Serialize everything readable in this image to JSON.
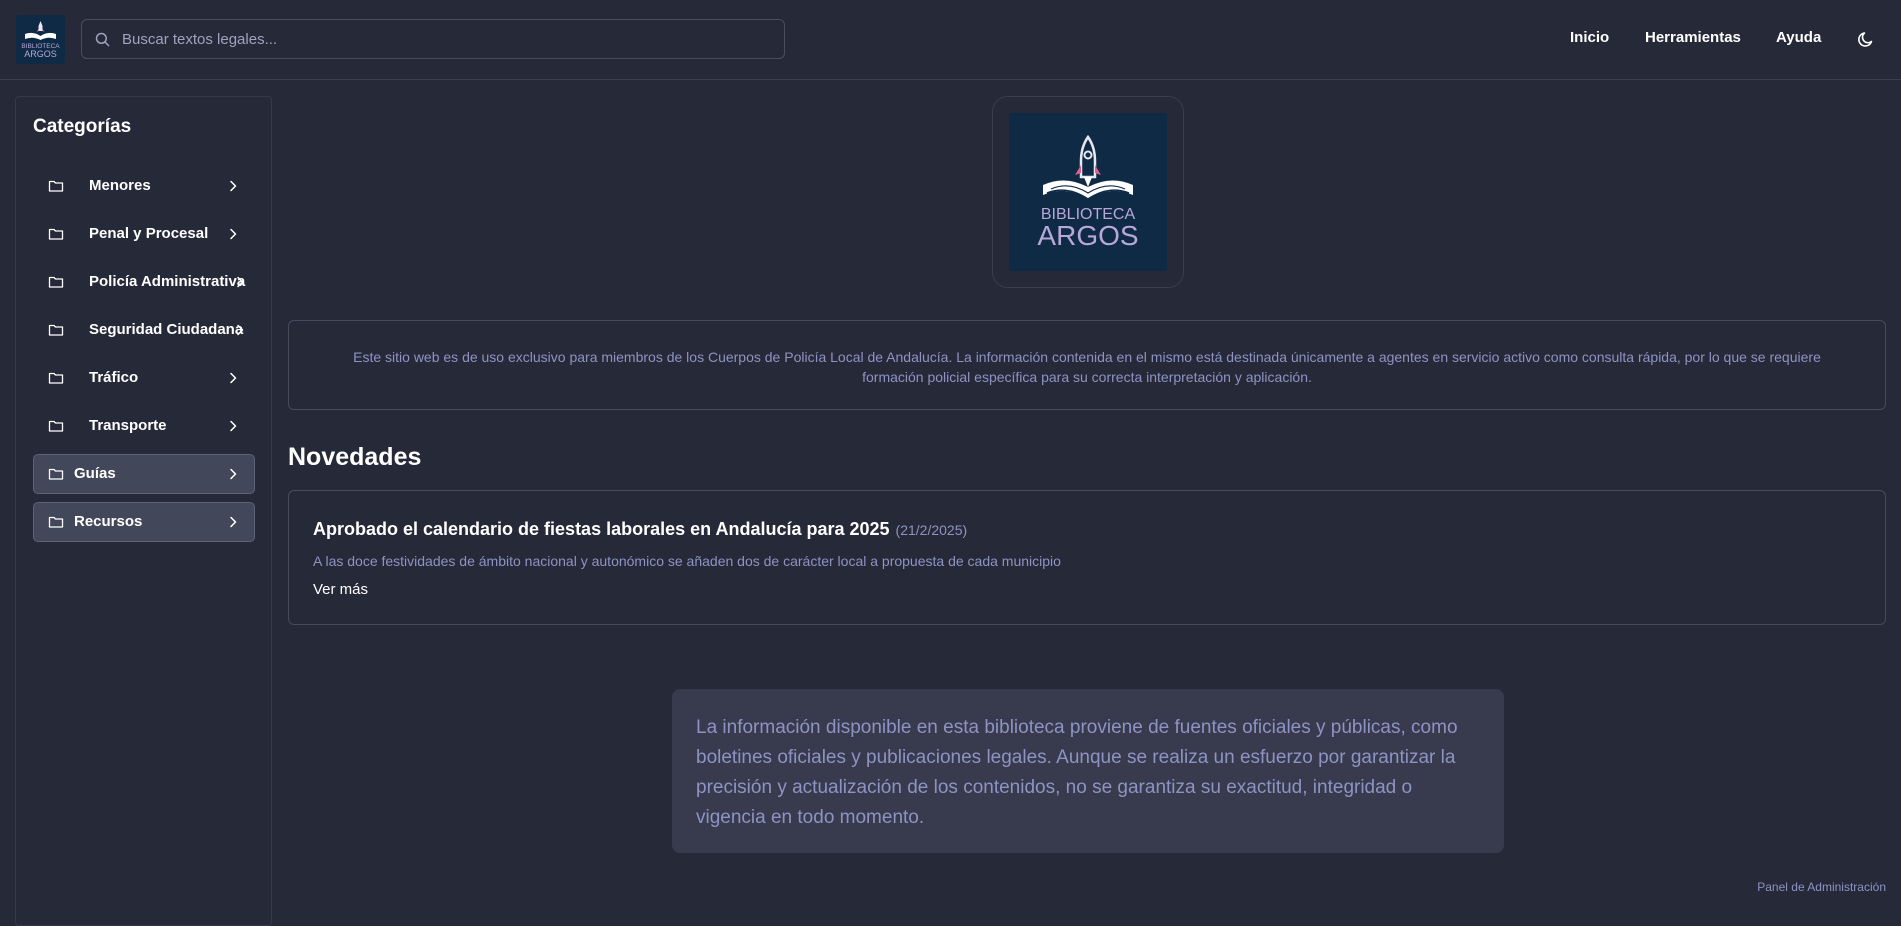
{
  "app": {
    "logo_text_top": "BIBLIOTECA",
    "logo_text_bottom": "ARGOS"
  },
  "header": {
    "search": {
      "placeholder": "Buscar textos legales...",
      "value": ""
    },
    "nav": [
      {
        "label": "Inicio"
      },
      {
        "label": "Herramientas"
      },
      {
        "label": "Ayuda"
      }
    ],
    "theme_toggle_icon": "moon-icon"
  },
  "sidebar": {
    "title": "Categorías",
    "items": [
      {
        "label": "Menores",
        "active": false
      },
      {
        "label": "Penal y Procesal",
        "active": false
      },
      {
        "label": "Policía Administrativa",
        "active": false
      },
      {
        "label": "Seguridad Ciudadana",
        "active": false
      },
      {
        "label": "Tráfico",
        "active": false
      },
      {
        "label": "Transporte",
        "active": false
      },
      {
        "label": "Guías",
        "active": true
      },
      {
        "label": "Recursos",
        "active": true
      }
    ]
  },
  "main": {
    "notice": "Este sitio web es de uso exclusivo para miembros de los Cuerpos de Policía Local de Andalucía. La información contenida en el mismo está destinada únicamente a agentes en servicio activo como consulta rápida, por lo que se requiere formación policial específica para su correcta interpretación y aplicación.",
    "news_section_title": "Novedades",
    "news": [
      {
        "title": "Aprobado el calendario de fiestas laborales en Andalucía para 2025",
        "date": "(21/2/2025)",
        "summary": "A las doce festividades de ámbito nacional y autonómico se añaden dos de carácter local a propuesta de cada municipio",
        "more_label": "Ver más"
      }
    ],
    "disclaimer": "La información disponible en esta biblioteca proviene de fuentes oficiales y públicas, como boletines oficiales y publicaciones legales. Aunque se realiza un esfuerzo por garantizar la precisión y actualización de los contenidos, no se garantiza su exactitud, integridad o vigencia en todo momento.",
    "admin_link": "Panel de Administración"
  },
  "colors": {
    "background": "#262938",
    "border": "#474a5c",
    "muted_text": "#8e93c3",
    "logo_background": "#0e2a45",
    "logo_text": "#b8a7d9",
    "rocket_accent": "#e0608f"
  }
}
